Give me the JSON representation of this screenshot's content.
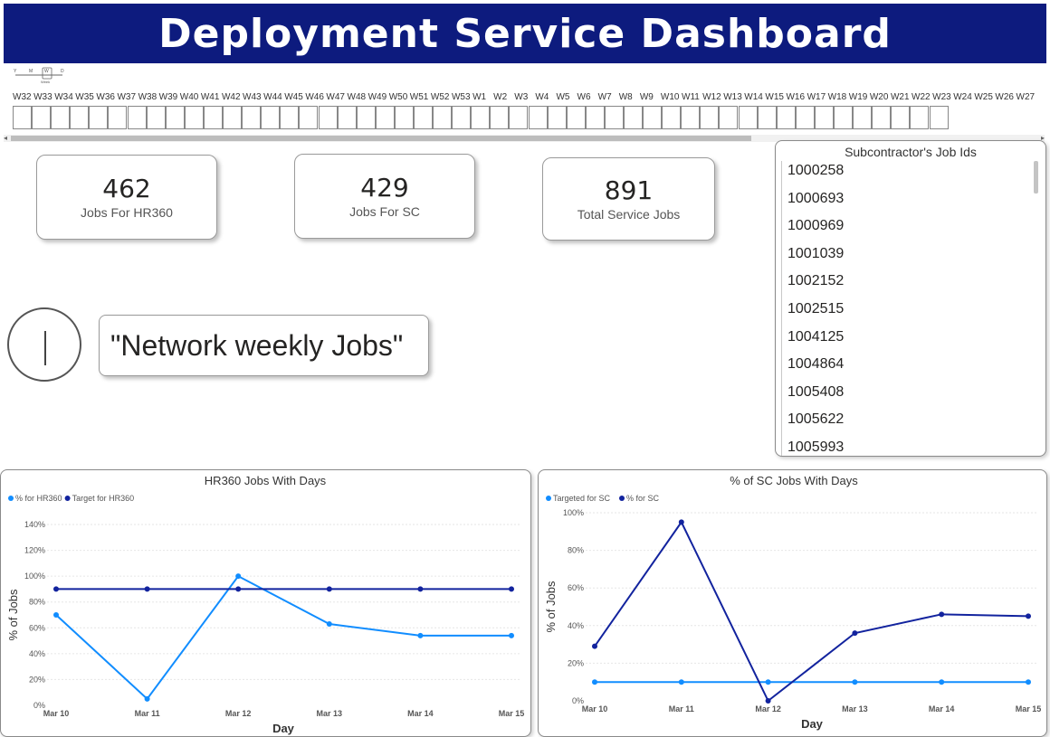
{
  "header": {
    "title": "Deployment Service Dashboard"
  },
  "slicer": {
    "granularity_labels": [
      "Y",
      "M",
      "W",
      "D"
    ],
    "granularity_caption": "Week",
    "weeks": [
      "W32",
      "W33",
      "W34",
      "W35",
      "W36",
      "W37",
      "W38",
      "W39",
      "W40",
      "W41",
      "W42",
      "W43",
      "W44",
      "W45",
      "W46",
      "W47",
      "W48",
      "W49",
      "W50",
      "W51",
      "W52",
      "W53",
      "W1",
      "W2",
      "W3",
      "W4",
      "W5",
      "W6",
      "W7",
      "W8",
      "W9",
      "W10",
      "W11",
      "W12",
      "W13",
      "W14",
      "W15",
      "W16",
      "W17",
      "W18",
      "W19",
      "W20",
      "W21",
      "W22",
      "W23",
      "W24",
      "W25",
      "W26",
      "W27"
    ]
  },
  "cards": [
    {
      "value": "462",
      "label": "Jobs For HR360"
    },
    {
      "value": "429",
      "label": "Jobs For SC"
    },
    {
      "value": "891",
      "label": "Total Service Jobs"
    }
  ],
  "job_list": {
    "title": "Subcontractor's Job Ids",
    "items": [
      "1000258",
      "1000693",
      "1000969",
      "1001039",
      "1002152",
      "1002515",
      "1004125",
      "1004864",
      "1005408",
      "1005622",
      "1005993"
    ]
  },
  "network": {
    "label": "\"Network weekly Jobs\""
  },
  "chart_data": [
    {
      "type": "line",
      "title": "HR360 Jobs With Days",
      "xlabel": "Day",
      "ylabel": "% of Jobs",
      "categories": [
        "Mar 10",
        "Mar 11",
        "Mar 12",
        "Mar 13",
        "Mar 14",
        "Mar 15"
      ],
      "y_ticks": [
        "0%",
        "20%",
        "40%",
        "60%",
        "80%",
        "100%",
        "120%",
        "140%"
      ],
      "ylim": [
        0,
        140
      ],
      "legend": "top-left",
      "grid": true,
      "series": [
        {
          "name": "% for HR360",
          "color": "#118dff",
          "values": [
            70,
            5,
            100,
            63,
            54,
            54
          ]
        },
        {
          "name": "Target for HR360",
          "color": "#12239e",
          "values": [
            90,
            90,
            90,
            90,
            90,
            90
          ]
        }
      ]
    },
    {
      "type": "line",
      "title": "% of SC Jobs With Days",
      "xlabel": "Day",
      "ylabel": "% of Jobs",
      "categories": [
        "Mar 10",
        "Mar 11",
        "Mar 12",
        "Mar 13",
        "Mar 14",
        "Mar 15"
      ],
      "y_ticks": [
        "0%",
        "20%",
        "40%",
        "60%",
        "80%",
        "100%"
      ],
      "ylim": [
        0,
        100
      ],
      "legend": "top-left",
      "grid": true,
      "series": [
        {
          "name": "Targeted for SC",
          "color": "#118dff",
          "values": [
            10,
            10,
            10,
            10,
            10,
            10
          ]
        },
        {
          "name": "% for SC",
          "color": "#12239e",
          "values": [
            29,
            95,
            0,
            36,
            46,
            45
          ]
        }
      ]
    }
  ]
}
